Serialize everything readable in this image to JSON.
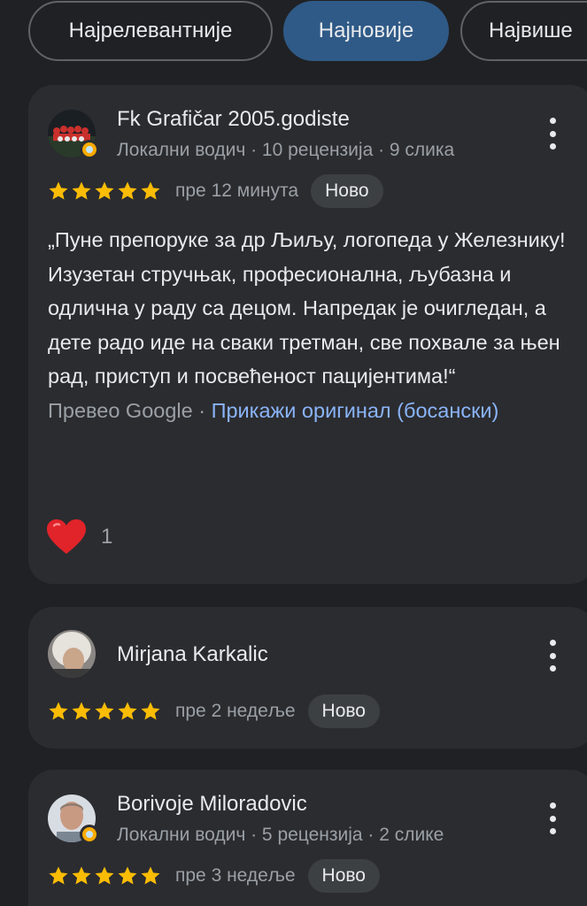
{
  "filters": [
    "Најрелевантније",
    "Најновије",
    "Највише"
  ],
  "active_filter": "Најновије",
  "colors": {
    "star": "#fbbc04",
    "link": "#8ab4f8",
    "heart": "#e0242a",
    "active_chip": "#2f5a87"
  },
  "reviews": [
    {
      "author": "Fk Grafičar 2005.godiste",
      "meta": "Локални водич · 10 рецензија · 9 слика",
      "rating": 5,
      "time": "пре 12 минута",
      "badge": "Ново",
      "text": "„Пуне препоруке за др Љиљу, логопеда у Железнику! Изузетан стручњак, професионална, љубазна и одлична у раду са децом. Напредак је очигледан, а дете радо иде на сваки третман, све похвале за њен рад, приступ и посвећеност пацијентима!“",
      "translated_by": "Превео Google",
      "separator": " · ",
      "show_original": "Прикажи оригинал (босански)",
      "reaction_count": "1"
    },
    {
      "author": "Mirjana Karkalic",
      "rating": 5,
      "time": "пре 2 недеље",
      "badge": "Ново"
    },
    {
      "author": "Borivoje Miloradovic",
      "meta": "Локални водич · 5 рецензија · 2 слике",
      "rating": 5,
      "time": "пре 3 недеље",
      "badge": "Ново"
    }
  ]
}
